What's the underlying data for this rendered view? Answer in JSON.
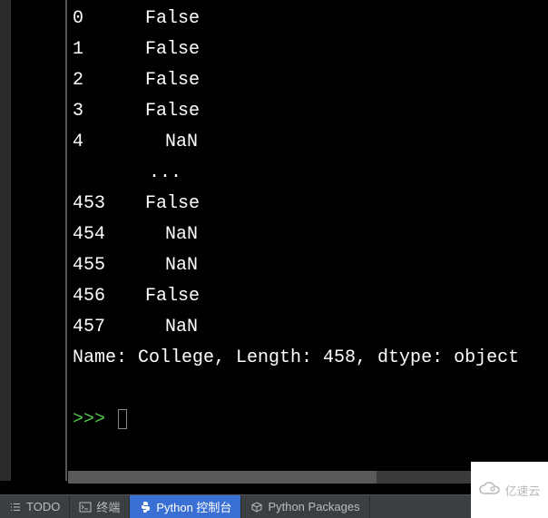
{
  "chart_data": {
    "type": "table",
    "title": "Pandas Series output",
    "rows": [
      {
        "index": "0",
        "value": "False"
      },
      {
        "index": "1",
        "value": "False"
      },
      {
        "index": "2",
        "value": "False"
      },
      {
        "index": "3",
        "value": "False"
      },
      {
        "index": "4",
        "value": "NaN"
      },
      {
        "index": "453",
        "value": "False"
      },
      {
        "index": "454",
        "value": "NaN"
      },
      {
        "index": "455",
        "value": "NaN"
      },
      {
        "index": "456",
        "value": "False"
      },
      {
        "index": "457",
        "value": "NaN"
      }
    ],
    "ellipsis": "       ...  ",
    "summary": "Name: College, Length: 458, dtype: object"
  },
  "console": {
    "prompt": ">>> "
  },
  "tabs": {
    "todo": {
      "label": "TODO"
    },
    "terminal": {
      "label": "终端"
    },
    "python_console": {
      "label": "Python 控制台"
    },
    "packages": {
      "label": "Python Packages"
    }
  },
  "watermark": {
    "text": "亿速云"
  }
}
